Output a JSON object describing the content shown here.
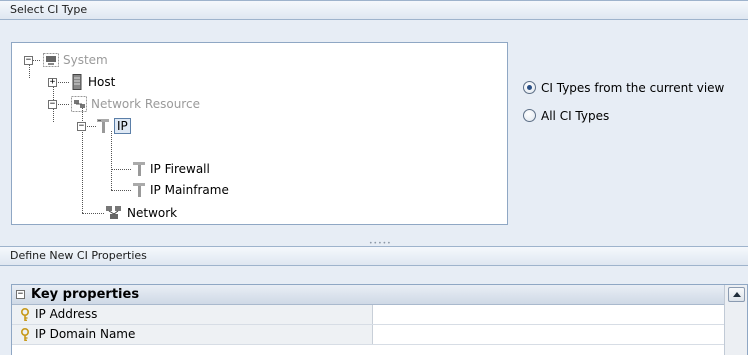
{
  "select_panel": {
    "title": "Select CI Type",
    "tree": {
      "root": {
        "label": "System",
        "expander": "−"
      },
      "host": {
        "label": "Host",
        "expander": "+"
      },
      "network_resource": {
        "label": "Network Resource",
        "expander": "−"
      },
      "ip": {
        "label": "IP",
        "expander": "−",
        "selected": true
      },
      "ip_firewall": {
        "label": "IP Firewall"
      },
      "ip_mainframe": {
        "label": "IP Mainframe"
      },
      "network": {
        "label": "Network"
      }
    },
    "radio_options": [
      {
        "label": "CI Types from the current view",
        "checked": true
      },
      {
        "label": "All CI Types",
        "checked": false
      }
    ]
  },
  "splitter": {
    "grip": "•••••"
  },
  "properties_panel": {
    "title": "Define New CI Properties",
    "group": {
      "label": "Key properties",
      "expander": "−"
    },
    "rows": [
      {
        "name": "IP Address",
        "value": ""
      },
      {
        "name": "IP Domain Name",
        "value": ""
      }
    ]
  },
  "colors": {
    "accent": "#2a4f85",
    "header_bg": "#dfe7f1",
    "panel_bg": "#e7edf5",
    "border": "#8fa7c4"
  }
}
